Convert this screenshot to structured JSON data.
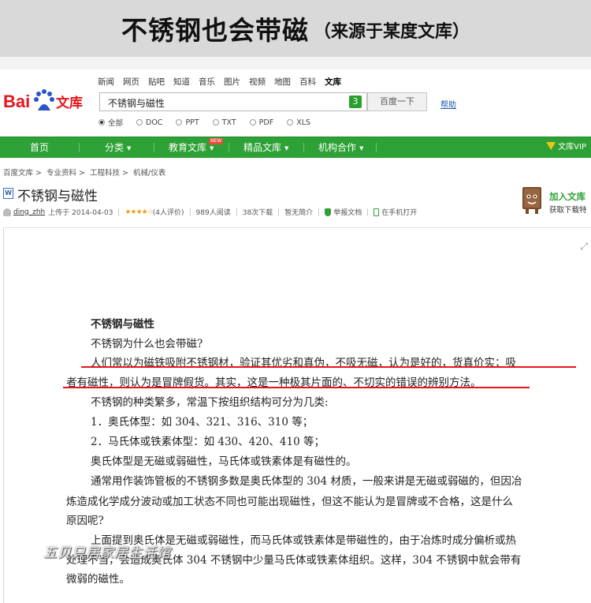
{
  "banner": {
    "title": "不锈钢也会带磁",
    "source": "（来源于某度文库）"
  },
  "top_nav": [
    "新闻",
    "网页",
    "贴吧",
    "知道",
    "音乐",
    "图片",
    "视频",
    "地图",
    "百科",
    "文库"
  ],
  "search": {
    "query": "不锈钢与磁性",
    "badge": "3",
    "button": "百度一下",
    "help": "帮助"
  },
  "file_types": [
    {
      "label": "全部",
      "selected": true
    },
    {
      "label": "DOC",
      "selected": false
    },
    {
      "label": "PPT",
      "selected": false
    },
    {
      "label": "TXT",
      "selected": false
    },
    {
      "label": "PDF",
      "selected": false
    },
    {
      "label": "XLS",
      "selected": false
    }
  ],
  "green_nav": {
    "home": "首页",
    "category": "分类",
    "edu": "教育文库",
    "new_badge": "NEW",
    "premium": "精品文库",
    "org": "机构合作",
    "vip": "文库VIP"
  },
  "breadcrumb": [
    "百度文库",
    "专业资料",
    "工程科技",
    "机械/仪表"
  ],
  "document": {
    "icon": "W",
    "title": "不锈钢与磁性",
    "uploader": "ding_zhh",
    "uploaded_on": "上传于 2014-04-03",
    "stars": "★★★★☆",
    "ratings": "(4人评价)",
    "reads": "989人阅读",
    "downloads": "38次下载",
    "summary": "暂无简介",
    "report": "举报文档",
    "mobile": "在手机打开"
  },
  "add_library": {
    "label": "加入文库",
    "sub": "获取下载特"
  },
  "content": {
    "heading": "不锈钢与磁性",
    "lines": [
      "不锈钢为什么也会带磁?",
      "人们常以为磁铁吸附不锈钢材，验证其优劣和真伪，不吸无磁，认为是好的，货真价实；吸",
      "者有磁性，则认为是冒牌假货。其实，这是一种极其片面的、不切实的错误的辨别方法。",
      "不锈钢的种类繁多，常温下按组织结构可分为几类:",
      "1．奥氏体型：如 304、321、316、310 等；",
      "2．马氏体或铁素体型：如 430、420、410 等；",
      "奥氏体型是无磁或弱磁性，马氏体或铁素体是有磁性的。",
      "通常用作装饰管板的不锈钢多数是奥氏体型的 304 材质，一般来讲是无磁或弱磁的，但因冶",
      "炼造成化学成分波动或加工状态不同也可能出现磁性，但这不能认为是冒牌或不合格，这是什么",
      "原因呢?",
      "上面提到奥氏体是无磁或弱磁性，而马氏体或铁素体是带磁性的，由于冶炼时成分偏析或热",
      "处理不当，会造成奥氏体 304 不锈钢中少量马氏体或铁素体组织。这样，304 不锈钢中就会带有",
      "微弱的磁性。"
    ]
  },
  "watermark": "五贝只居家居生活馆",
  "colors": {
    "nav_green": "#2da135",
    "underline_red": "#e3161c",
    "banner_gray": "#d9d9d9"
  }
}
